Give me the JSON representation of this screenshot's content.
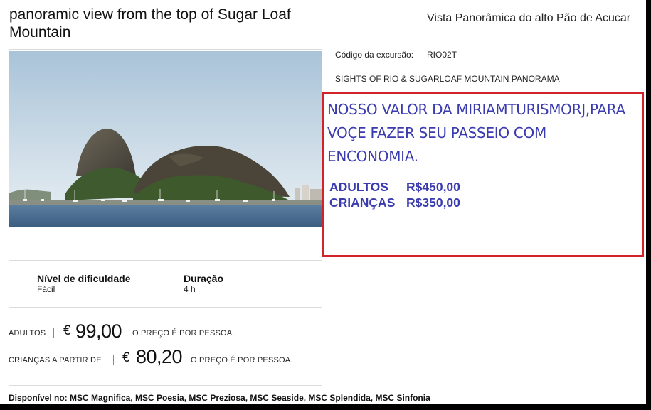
{
  "header": {
    "title": "panoramic view from the top of Sugar Loaf Mountain",
    "subtitle_pt": "Vista Panorâmica do alto Pão de Acucar"
  },
  "details": {
    "code_label": "Código da excursão:",
    "code_value": "RIO02T",
    "sights": "SIGHTS OF RIO & SUGARLOAF MOUNTAIN PANORAMA"
  },
  "promo": {
    "text": "NOSSO VALOR DA MIRIAMTURISMORJ,PARA VOÇE FAZER SEU PASSEIO COM ENCONOMIA.",
    "adults_label": "ADULTOS",
    "adults_price": "R$450,00",
    "children_label": "CRIANÇAS",
    "children_price": "R$350,00",
    "border_color": "#d2232a",
    "text_color": "#3b3bb0"
  },
  "info": {
    "difficulty_label": "Nível de dificuldade",
    "difficulty_value": "Fácil",
    "duration_label": "Duração",
    "duration_value": "4 h"
  },
  "prices": {
    "adults_label": "ADULTOS",
    "adults_currency": "€",
    "adults_amount": "99,00",
    "adults_note": "O PREÇO É POR PESSOA.",
    "children_label": "CRIANÇAS A PARTIR DE",
    "children_currency": "€",
    "children_amount": "80,20",
    "children_note": "O PREÇO É POR PESSOA."
  },
  "available": "Disponível no: MSC Magnifica, MSC Poesia, MSC Preziosa, MSC Seaside, MSC Splendida, MSC Sinfonia"
}
